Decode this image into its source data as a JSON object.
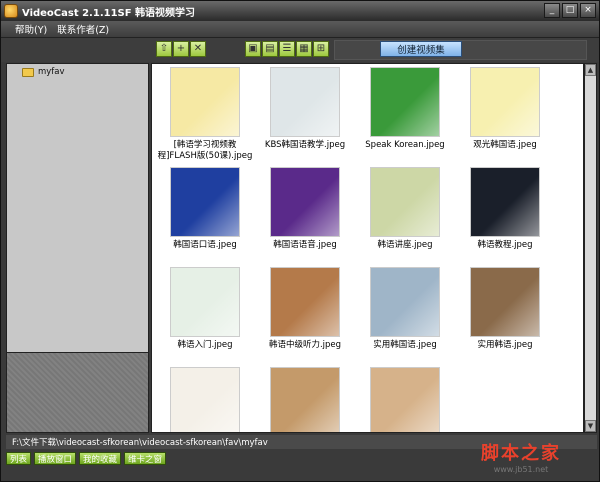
{
  "window": {
    "title": "VideoCast 2.1.11SF 韩语视频学习"
  },
  "titlebar_buttons": {
    "minimize": "_",
    "maximize": "□",
    "close": "×"
  },
  "menu": {
    "items": [
      "帮助(Y)",
      "联系作者(Z)"
    ]
  },
  "toolbar": {
    "buttons_left": [
      {
        "icon": "folder-up-icon",
        "glyph": "⇧"
      },
      {
        "icon": "new-folder-icon",
        "glyph": "+"
      },
      {
        "icon": "delete-icon",
        "glyph": "✕"
      }
    ],
    "buttons_view": [
      {
        "icon": "view-large-icon",
        "glyph": "▣"
      },
      {
        "icon": "view-medium-icon",
        "glyph": "▤"
      },
      {
        "icon": "view-list-icon",
        "glyph": "☰"
      },
      {
        "icon": "view-details-icon",
        "glyph": "▦"
      },
      {
        "icon": "view-grid-icon",
        "glyph": "⊞"
      }
    ],
    "create_label": "创建视频集"
  },
  "sidebar": {
    "items": [
      {
        "label": "myfav",
        "icon": "folder-icon"
      }
    ]
  },
  "files": [
    {
      "name": "[韩语学习视频教程]FLASH版(50课).jpeg",
      "thumb_color": "#f6e9a4"
    },
    {
      "name": "KBS韩国语教学.jpeg",
      "thumb_color": "#dfe6e8"
    },
    {
      "name": "Speak Korean.jpeg",
      "thumb_color": "#3a9a3a"
    },
    {
      "name": "观光韩国语.jpeg",
      "thumb_color": "#f7f0b0"
    },
    {
      "name": "韩国语口语.jpeg",
      "thumb_color": "#1f3fa0"
    },
    {
      "name": "韩国语语音.jpeg",
      "thumb_color": "#5a2a8a"
    },
    {
      "name": "韩语讲座.jpeg",
      "thumb_color": "#cdd7a6"
    },
    {
      "name": "韩语教程.jpeg",
      "thumb_color": "#1a1f2a"
    },
    {
      "name": "韩语入门.jpeg",
      "thumb_color": "#e6f0e6"
    },
    {
      "name": "韩语中级听力.jpeg",
      "thumb_color": "#b47a4a"
    },
    {
      "name": "实用韩国语.jpeg",
      "thumb_color": "#9fb5c8"
    },
    {
      "name": "实用韩语.jpeg",
      "thumb_color": "#8a6a4a"
    },
    {
      "name": "",
      "thumb_color": "#f4f0e8"
    },
    {
      "name": "",
      "thumb_color": "#c49a6a"
    },
    {
      "name": "",
      "thumb_color": "#d6b28a"
    }
  ],
  "pathbar": {
    "path": "F:\\文件下载\\videocast-sfkorean\\videocast-sfkorean\\fav\\myfav"
  },
  "status": {
    "buttons": [
      "列表",
      "播放窗口",
      "我的收藏",
      "维卡之窗"
    ]
  },
  "watermark": {
    "title": "脚本之家",
    "url": "www.jb51.net"
  }
}
